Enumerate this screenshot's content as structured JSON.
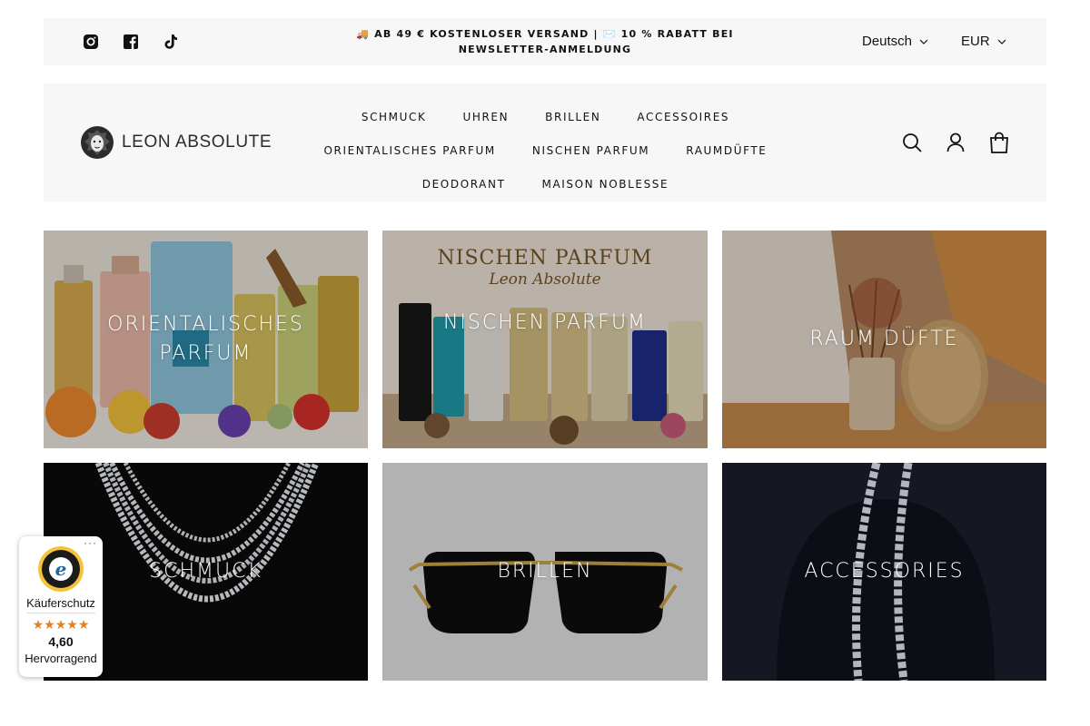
{
  "announcement": {
    "text_line1": "🚚 AB 49 € KOSTENLOSER VERSAND | ✉️ 10 % RABATT BEI",
    "text_line2": "NEWSLETTER-ANMELDUNG",
    "social_icons": [
      "instagram-icon",
      "facebook-icon",
      "tiktok-icon"
    ],
    "language": "Deutsch",
    "currency": "EUR"
  },
  "header": {
    "logo_text": "LEON ABSOLUTE",
    "nav_rows": [
      [
        "SCHMUCK",
        "UHREN",
        "BRILLEN",
        "ACCESSOIRES"
      ],
      [
        "ORIENTALISCHES PARFUM",
        "NISCHEN PARFUM",
        "RAUMDÜFTE"
      ],
      [
        "DEODORANT",
        "MAISON NOBLESSE"
      ]
    ],
    "icons": [
      "search-icon",
      "account-icon",
      "cart-icon"
    ]
  },
  "collections": [
    {
      "label": "ORIENTALISCHES PARFUM",
      "bg": "#d8c6a8"
    },
    {
      "label": "NISCHEN PARFUM",
      "bg": "#6d5d4a",
      "banner_title": "NISCHEN PARFUM",
      "banner_subtitle": "Leon Absolute"
    },
    {
      "label": "RAUM DÜFTE",
      "bg": "#9a7454"
    },
    {
      "label": "SCHMUCK",
      "bg": "#111111"
    },
    {
      "label": "BRILLEN",
      "bg": "#cfcfcf"
    },
    {
      "label": "ACCESSORIES",
      "bg": "#1c2030"
    }
  ],
  "trust_badge": {
    "label": "Käuferschutz",
    "stars": "★★★★★",
    "score": "4,60",
    "rating_text": "Hervorragend",
    "menu": "···"
  },
  "colors": {
    "bar_bg": "#f7f7f7",
    "text": "#121212",
    "star": "#e67e22"
  }
}
